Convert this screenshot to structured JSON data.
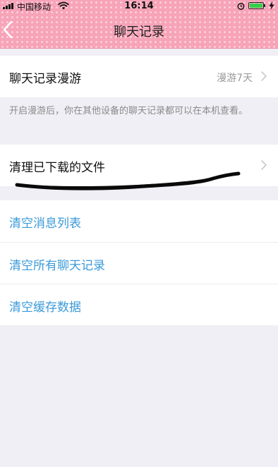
{
  "status_bar": {
    "carrier": "中国移动",
    "time": "16:14",
    "battery_color": "#35d04b"
  },
  "nav": {
    "back_icon": "chevron-left-icon",
    "title": "聊天记录"
  },
  "roaming": {
    "label": "聊天记录漫游",
    "value": "漫游7天",
    "hint": "开启漫游后，你在其他设备的聊天记录都可以在本机查看。"
  },
  "files": {
    "label": "清理已下载的文件"
  },
  "actions": {
    "clear_message_list": "清空消息列表",
    "clear_all_chats": "清空所有聊天记录",
    "clear_cache": "清空缓存数据"
  },
  "colors": {
    "header_pink": "#f7a3b8",
    "action_blue": "#3a9ad9",
    "background": "#f0eff5"
  }
}
